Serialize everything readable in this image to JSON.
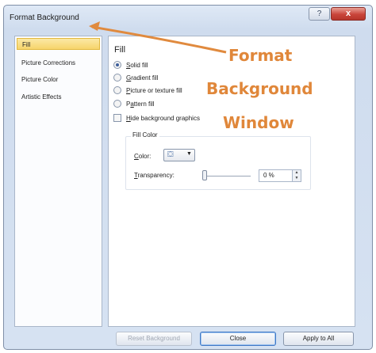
{
  "window": {
    "title": "Format Background",
    "help_glyph": "?",
    "close_glyph": "x"
  },
  "sidebar": {
    "items": [
      {
        "label": "Fill",
        "selected": true
      },
      {
        "label": "Picture Corrections",
        "selected": false
      },
      {
        "label": "Picture Color",
        "selected": false
      },
      {
        "label": "Artistic Effects",
        "selected": false
      }
    ]
  },
  "fill": {
    "heading": "Fill",
    "options": [
      {
        "hotkey": "S",
        "rest": "olid fill",
        "checked": true
      },
      {
        "hotkey": "G",
        "rest": "radient fill",
        "checked": false
      },
      {
        "hotkey": "P",
        "rest": "icture or texture fill",
        "checked": false
      },
      {
        "pre": "P",
        "hotkey": "a",
        "rest": "ttern fill",
        "checked": false
      }
    ],
    "hide_graphics": {
      "hotkey": "H",
      "rest": "ide background graphics",
      "checked": false
    },
    "fill_color_group": "Fill Color",
    "color_label": {
      "hotkey": "C",
      "rest": "olor:"
    },
    "transparency_label": {
      "hotkey": "T",
      "rest": "ransparency:"
    },
    "transparency_value": "0 %",
    "transparency_level": 0,
    "spin_up": "▲",
    "spin_down": "▼"
  },
  "annotation": {
    "line1": "Format",
    "line2": "Background",
    "line3": "Window",
    "color": "#e0873a"
  },
  "footer": {
    "reset_label": "Reset Background",
    "close_label": "Close",
    "apply_label": "Apply to All"
  }
}
